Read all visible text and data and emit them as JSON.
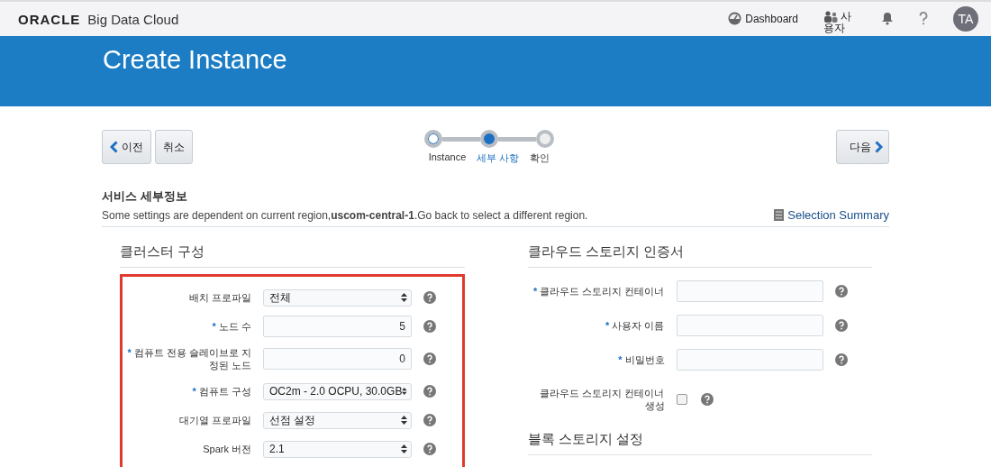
{
  "header": {
    "brand": "ORACLE",
    "product": "Big Data Cloud",
    "dashboard": "Dashboard",
    "user": "사용자",
    "avatar": "TA"
  },
  "banner": {
    "title": "Create Instance"
  },
  "nav": {
    "back": "이전",
    "cancel": "취소",
    "next": "다음"
  },
  "steps": [
    {
      "label": "Instance",
      "kind": "done"
    },
    {
      "label": "세부 사항",
      "kind": "current"
    },
    {
      "label": "확인",
      "kind": "todo"
    }
  ],
  "required_mark": "*",
  "section": {
    "title": "서비스 세부정보",
    "description": "Some settings are dependent on current region,**uscom-central-1**.Go back to select a different region.",
    "summary_link": "Selection Summary"
  },
  "cluster": {
    "title": "클러스터 구성",
    "fields": [
      {
        "label": "배치 프로파일",
        "kind": "select",
        "required": false,
        "value": "전체"
      },
      {
        "label": "노드 수",
        "kind": "input",
        "required": true,
        "value": "5"
      },
      {
        "label": "컴퓨트 전용 슬레이브로 지정된 노드",
        "kind": "input",
        "required": true,
        "value": "0"
      },
      {
        "label": "컴퓨트 구성",
        "kind": "select",
        "required": true,
        "value": "OC2m - 2.0 OCPU, 30.0GB"
      },
      {
        "label": "대기열 프로파일",
        "kind": "select",
        "required": false,
        "value": "선점 설정"
      },
      {
        "label": "Spark 버전",
        "kind": "select",
        "required": false,
        "value": "2.1"
      }
    ]
  },
  "storage": {
    "title": "클라우드 스토리지 인증서",
    "fields": [
      {
        "label": "클라우드 스토리지 컨테이너",
        "kind": "input",
        "required": true
      },
      {
        "label": "사용자 이름",
        "kind": "input",
        "required": true
      },
      {
        "label": "비밀번호",
        "kind": "input",
        "required": true
      },
      {
        "label": "클라우드 스토리지 컨테이너 생성",
        "kind": "checkbox",
        "required": false,
        "checked": false
      }
    ]
  },
  "block_storage": {
    "title": "블록 스토리지 설정"
  }
}
